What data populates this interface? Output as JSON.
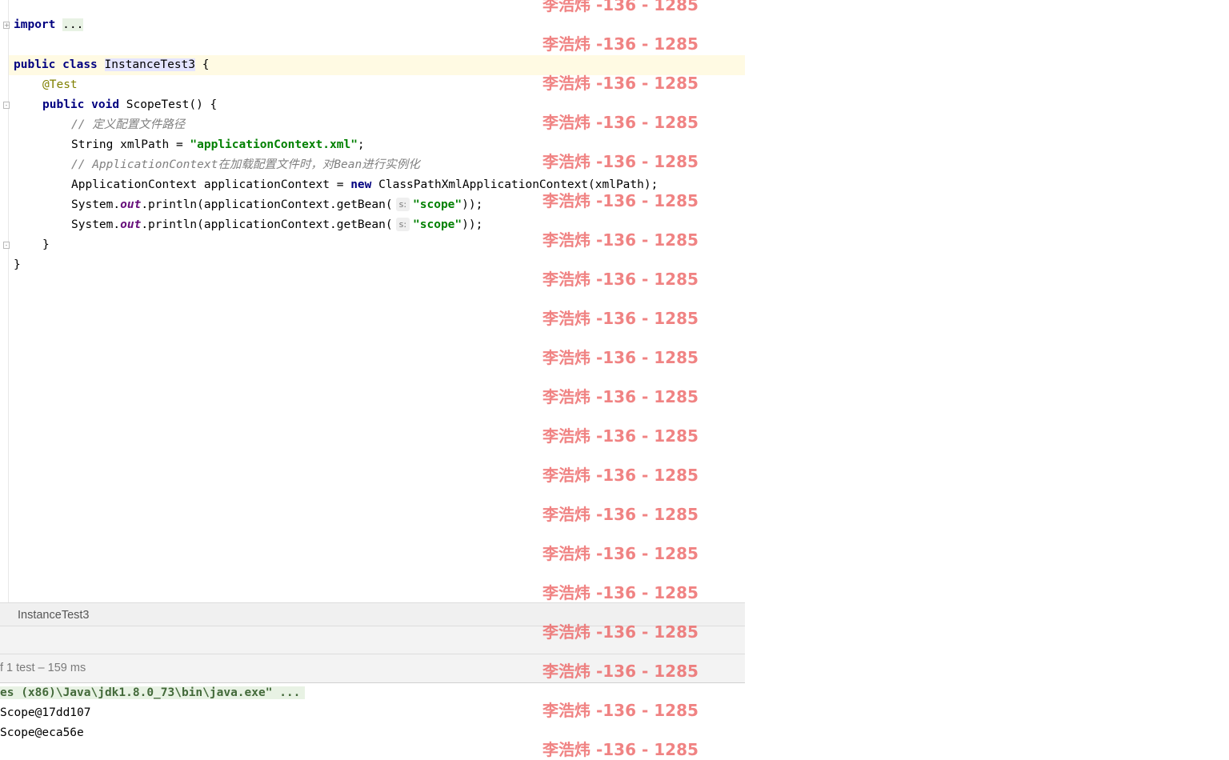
{
  "editor": {
    "lines": {
      "import_kw": "import",
      "import_dots": "...",
      "class_public": "public",
      "class_kw": "class",
      "class_name": "InstanceTest3",
      "class_open": " {",
      "annotation": "@Test",
      "method_public": "public",
      "method_void": "void",
      "method_sig": "ScopeTest() {",
      "comment1": "// 定义配置文件路径",
      "xml_decl": "String xmlPath = ",
      "xml_value": "\"applicationContext.xml\"",
      "xml_end": ";",
      "comment2": "// ApplicationContext在加载配置文件时，对Bean进行实例化",
      "ctx_decl": "ApplicationContext applicationContext = ",
      "ctx_new": "new",
      "ctx_rest": " ClassPathXmlApplicationContext(xmlPath);",
      "print_prefix": "System.",
      "print_out": "out",
      "print_mid": ".println(applicationContext.getBean(",
      "param_hint": "s:",
      "scope_str": "\"scope\"",
      "print_end": "));",
      "method_close": "}",
      "class_close": "}"
    }
  },
  "run_panel": {
    "tab_label": "InstanceTest3",
    "status": "f 1 test – 159 ms",
    "console": [
      "es (x86)\\Java\\jdk1.8.0_73\\bin\\java.exe\" ...",
      "Scope@17dd107",
      "Scope@eca56e"
    ]
  },
  "watermark": {
    "text": "李浩炜 -136 - 1285"
  }
}
